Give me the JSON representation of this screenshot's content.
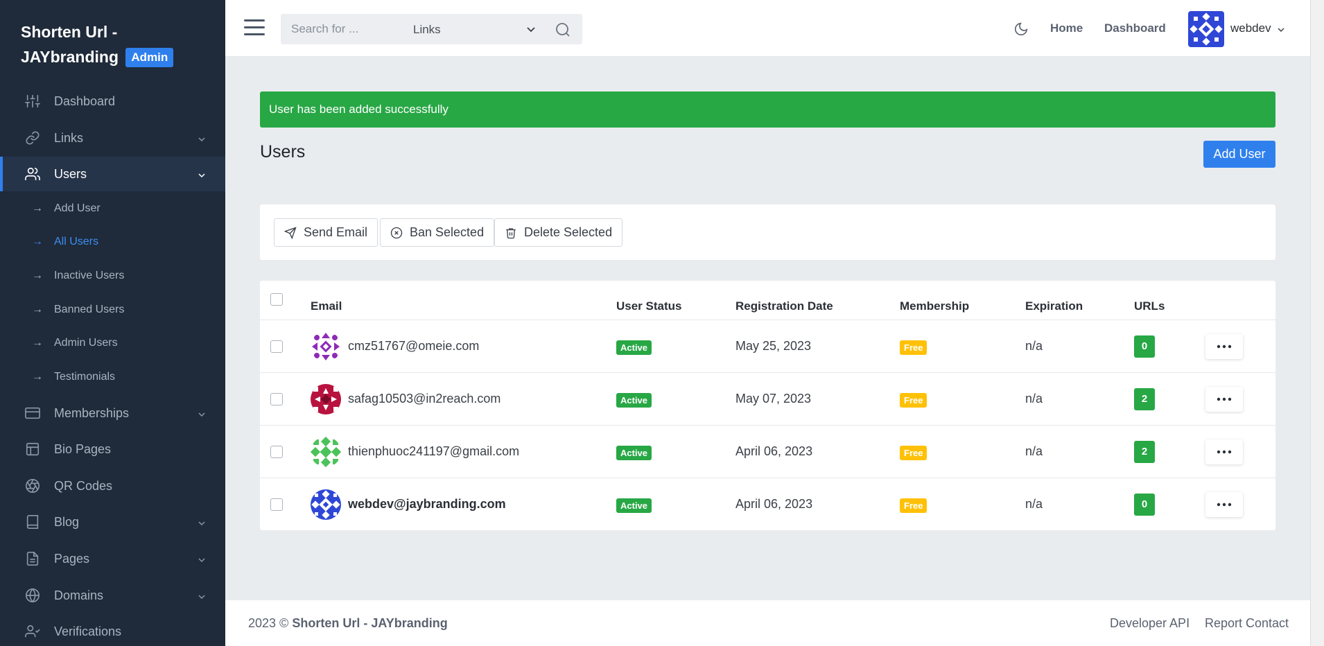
{
  "brand": {
    "title_line1": "Shorten Url -",
    "title_line2": "JAYbranding",
    "badge": "Admin"
  },
  "sidebar": {
    "items": [
      {
        "label": "Dashboard",
        "icon": "sliders-icon"
      },
      {
        "label": "Links",
        "icon": "link-icon"
      },
      {
        "label": "Users",
        "icon": "users-icon"
      },
      {
        "label": "Memberships",
        "icon": "credit-card-icon"
      },
      {
        "label": "Bio Pages",
        "icon": "layout-icon"
      },
      {
        "label": "QR Codes",
        "icon": "aperture-icon"
      },
      {
        "label": "Blog",
        "icon": "book-icon"
      },
      {
        "label": "Pages",
        "icon": "file-icon"
      },
      {
        "label": "Domains",
        "icon": "globe-icon"
      },
      {
        "label": "Verifications",
        "icon": "user-check-icon"
      }
    ],
    "subitems": [
      {
        "label": "Add User"
      },
      {
        "label": "All Users"
      },
      {
        "label": "Inactive Users"
      },
      {
        "label": "Banned Users"
      },
      {
        "label": "Admin Users"
      },
      {
        "label": "Testimonials"
      }
    ],
    "arrow": "→"
  },
  "topbar": {
    "search_placeholder": "Search for ...",
    "search_scope": "Links",
    "links": {
      "home": "Home",
      "dashboard": "Dashboard"
    },
    "username": "webdev"
  },
  "alert": {
    "message": "User has been added successfully",
    "color": "#28a745"
  },
  "page": {
    "title": "Users",
    "add_button": "Add User"
  },
  "actions": {
    "send_email": "Send Email",
    "ban_selected": "Ban Selected",
    "delete_selected": "Delete Selected"
  },
  "table": {
    "headers": {
      "email": "Email",
      "status": "User Status",
      "regdate": "Registration Date",
      "membership": "Membership",
      "expiration": "Expiration",
      "urls": "URLs"
    },
    "rows": [
      {
        "email": "cmz51767@omeie.com",
        "status": "Active",
        "regdate": "May 25, 2023",
        "membership": "Free",
        "expiration": "n/a",
        "urls": "0"
      },
      {
        "email": "safag10503@in2reach.com",
        "status": "Active",
        "regdate": "May 07, 2023",
        "membership": "Free",
        "expiration": "n/a",
        "urls": "2"
      },
      {
        "email": "thienphuoc241197@gmail.com",
        "status": "Active",
        "regdate": "April 06, 2023",
        "membership": "Free",
        "expiration": "n/a",
        "urls": "2"
      },
      {
        "email": "webdev@jaybranding.com",
        "status": "Active",
        "regdate": "April 06, 2023",
        "membership": "Free",
        "expiration": "n/a",
        "urls": "0"
      }
    ]
  },
  "footer": {
    "copy_prefix": "2023 ©",
    "copy_brand": "Shorten Url - JAYbranding",
    "links": {
      "api": "Developer API",
      "report": "Report",
      "contact": "Contact"
    }
  },
  "colors": {
    "sidebar_bg": "#1f2a3a",
    "accent": "#2f80ed",
    "success": "#28a745",
    "warning": "#ffc107"
  }
}
